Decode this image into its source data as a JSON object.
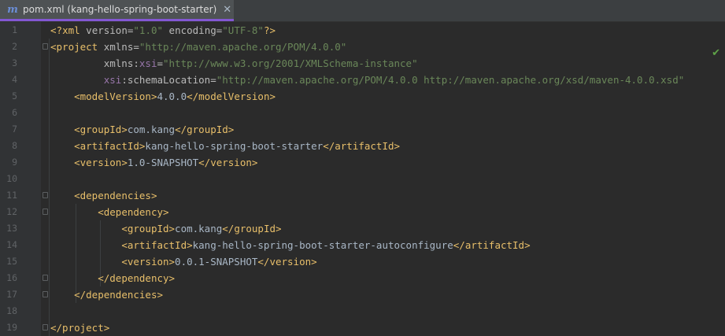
{
  "tab": {
    "label": "pom.xml (kang-hello-spring-boot-starter)",
    "icon": "maven-icon",
    "close": "✕"
  },
  "status": {
    "icon": "checkmark-icon",
    "glyph": "✔"
  },
  "colors": {
    "accent": "#8357d3",
    "tag": "#e8bf6a",
    "string": "#6a8759",
    "namespace": "#9876aa",
    "text": "#a9b7c6"
  },
  "lines": [
    {
      "n": "1",
      "segs": [
        [
          "t",
          "<?"
        ],
        [
          "t",
          "xml "
        ],
        [
          "a",
          "version="
        ],
        [
          "s",
          "\"1.0\" "
        ],
        [
          "a",
          "encoding="
        ],
        [
          "s",
          "\"UTF-8\""
        ],
        [
          "t",
          "?>"
        ]
      ]
    },
    {
      "n": "2",
      "segs": [
        [
          "t",
          "<project "
        ],
        [
          "a",
          "xmlns="
        ],
        [
          "s",
          "\"http://maven.apache.org/POM/4.0.0\""
        ]
      ]
    },
    {
      "n": "3",
      "segs": [
        [
          "p",
          "         "
        ],
        [
          "a",
          "xmlns:"
        ],
        [
          "ns",
          "xsi"
        ],
        [
          "a",
          "="
        ],
        [
          "s",
          "\"http://www.w3.org/2001/XMLSchema-instance\""
        ]
      ]
    },
    {
      "n": "4",
      "segs": [
        [
          "p",
          "         "
        ],
        [
          "ns",
          "xsi"
        ],
        [
          "a",
          ":schemaLocation="
        ],
        [
          "s",
          "\"http://maven.apache.org/POM/4.0.0 http://maven.apache.org/xsd/maven-4.0.0.xsd\""
        ]
      ]
    },
    {
      "n": "5",
      "segs": [
        [
          "p",
          "    "
        ],
        [
          "t",
          "<modelVersion>"
        ],
        [
          "p",
          "4.0.0"
        ],
        [
          "t",
          "</modelVersion>"
        ]
      ]
    },
    {
      "n": "6",
      "segs": []
    },
    {
      "n": "7",
      "segs": [
        [
          "p",
          "    "
        ],
        [
          "t",
          "<groupId>"
        ],
        [
          "p",
          "com.kang"
        ],
        [
          "t",
          "</groupId>"
        ]
      ]
    },
    {
      "n": "8",
      "segs": [
        [
          "p",
          "    "
        ],
        [
          "t",
          "<artifactId>"
        ],
        [
          "p",
          "kang-hello-spring-boot-starter"
        ],
        [
          "t",
          "</artifactId>"
        ]
      ]
    },
    {
      "n": "9",
      "segs": [
        [
          "p",
          "    "
        ],
        [
          "t",
          "<version>"
        ],
        [
          "p",
          "1.0-SNAPSHOT"
        ],
        [
          "t",
          "</version>"
        ]
      ]
    },
    {
      "n": "10",
      "segs": []
    },
    {
      "n": "11",
      "segs": [
        [
          "p",
          "    "
        ],
        [
          "t",
          "<dependencies>"
        ]
      ]
    },
    {
      "n": "12",
      "segs": [
        [
          "p",
          "        "
        ],
        [
          "t",
          "<dependency>"
        ]
      ]
    },
    {
      "n": "13",
      "segs": [
        [
          "p",
          "            "
        ],
        [
          "t",
          "<groupId>"
        ],
        [
          "p",
          "com.kang"
        ],
        [
          "t",
          "</groupId>"
        ]
      ]
    },
    {
      "n": "14",
      "segs": [
        [
          "p",
          "            "
        ],
        [
          "t",
          "<artifactId>"
        ],
        [
          "p",
          "kang-hello-spring-boot-starter-autoconfigure"
        ],
        [
          "t",
          "</artifactId>"
        ]
      ]
    },
    {
      "n": "15",
      "segs": [
        [
          "p",
          "            "
        ],
        [
          "t",
          "<version>"
        ],
        [
          "p",
          "0.0.1-SNAPSHOT"
        ],
        [
          "t",
          "</version>"
        ]
      ]
    },
    {
      "n": "16",
      "segs": [
        [
          "p",
          "        "
        ],
        [
          "t",
          "</dependency>"
        ]
      ]
    },
    {
      "n": "17",
      "segs": [
        [
          "p",
          "    "
        ],
        [
          "t",
          "</dependencies>"
        ]
      ]
    },
    {
      "n": "18",
      "segs": []
    },
    {
      "n": "19",
      "segs": [
        [
          "t",
          "</project>"
        ]
      ]
    }
  ],
  "folds": [
    "2",
    "11",
    "12",
    "16",
    "17",
    "19"
  ]
}
